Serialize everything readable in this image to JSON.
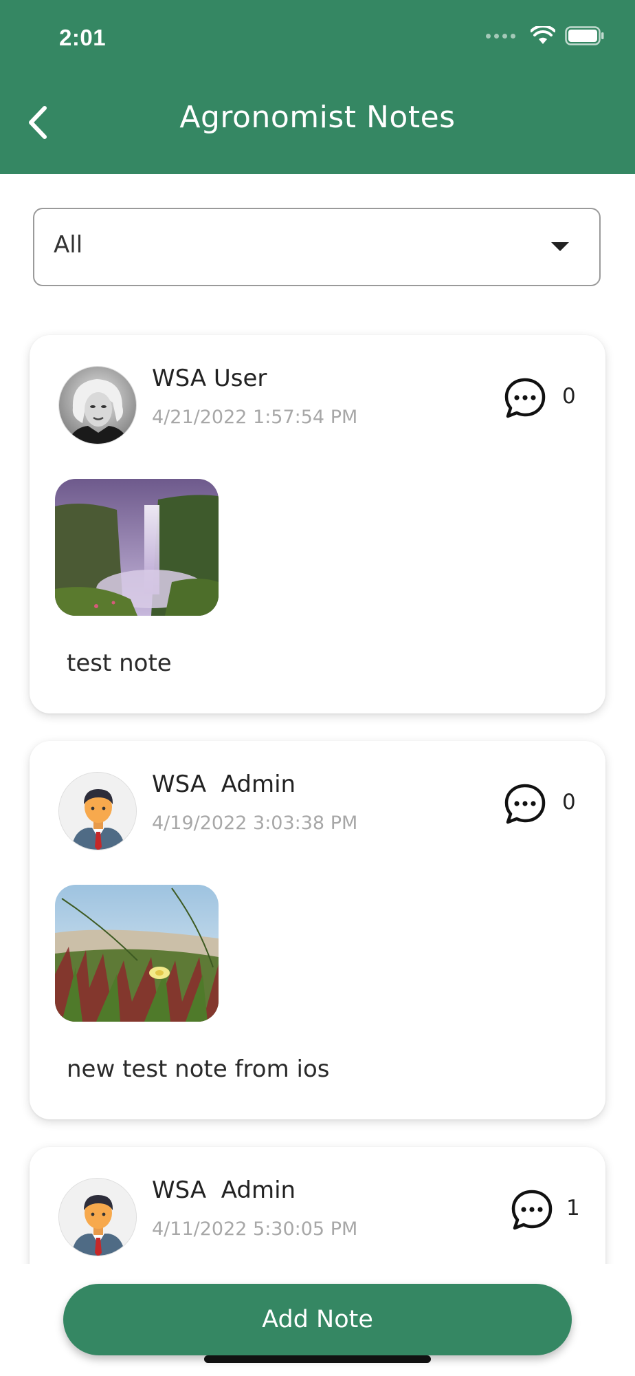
{
  "status_bar": {
    "time": "2:01"
  },
  "header": {
    "title": "Agronomist Notes",
    "back_icon": "chevron-left-icon"
  },
  "filter": {
    "selected": "All"
  },
  "notes": [
    {
      "author": "WSA User",
      "timestamp": "4/21/2022 1:57:54 PM",
      "comment_count": "0",
      "text": "test note",
      "avatar": "photo-portrait",
      "photo": "waterfall"
    },
    {
      "author": "WSA  Admin",
      "timestamp": "4/19/2022 3:03:38 PM",
      "comment_count": "0",
      "text": "new test note from ios",
      "avatar": "default-person",
      "photo": "grass-flower"
    },
    {
      "author": "WSA  Admin",
      "timestamp": "4/11/2022 5:30:05 PM",
      "comment_count": "1",
      "avatar": "default-person"
    }
  ],
  "actions": {
    "add_note_label": "Add Note"
  },
  "colors": {
    "brand_green": "#358763",
    "timestamp_gray": "#a7a7a7"
  }
}
